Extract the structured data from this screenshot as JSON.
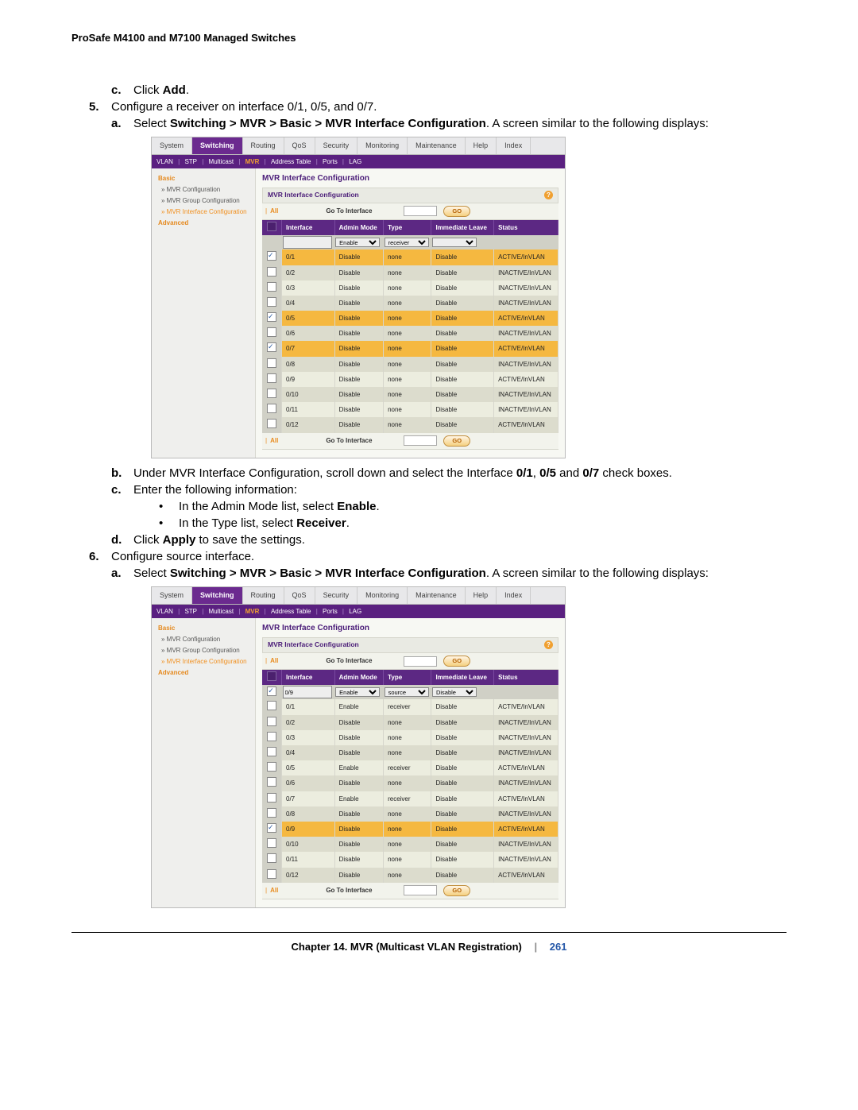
{
  "header": "ProSafe M4100 and M7100 Managed Switches",
  "instructions": {
    "c1": {
      "letter": "c.",
      "pre": "Click ",
      "bold": "Add",
      "post": "."
    },
    "five": {
      "num": "5.",
      "text": "Configure a receiver on interface 0/1, 0/5, and 0/7."
    },
    "a5": {
      "letter": "a.",
      "pre": "Select ",
      "bold": "Switching > MVR > Basic > MVR Interface Configuration",
      "post": ". A screen similar to the following displays:"
    },
    "b5": {
      "letter": "b.",
      "pre": "Under MVR Interface Configuration, scroll down and select the Interface ",
      "b1": "0/1",
      "m1": ", ",
      "b2": "0/5",
      "m2": " and ",
      "b3": "0/7",
      "post": " check boxes."
    },
    "c5": {
      "letter": "c.",
      "text": "Enter the following information:"
    },
    "bul1": {
      "pre": "In the Admin Mode list, select ",
      "bold": "Enable",
      "post": "."
    },
    "bul2": {
      "pre": "In the Type list, select ",
      "bold": "Receiver",
      "post": "."
    },
    "d5": {
      "letter": "d.",
      "pre": "Click ",
      "bold": "Apply",
      "post": " to save the settings."
    },
    "six": {
      "num": "6.",
      "text": "Configure source interface."
    },
    "a6": {
      "letter": "a.",
      "pre": "Select ",
      "bold": "Switching > MVR > Basic > MVR Interface Configuration",
      "post": ". A screen similar to the following displays:"
    }
  },
  "ui": {
    "tabs": [
      "System",
      "Switching",
      "Routing",
      "QoS",
      "Security",
      "Monitoring",
      "Maintenance",
      "Help",
      "Index"
    ],
    "activeTab": "Switching",
    "subtabs": [
      "VLAN",
      "STP",
      "Multicast",
      "MVR",
      "Address Table",
      "Ports",
      "LAG"
    ],
    "activeSub": "MVR",
    "sidebar": {
      "basic": "Basic",
      "mvrcfg": "» MVR Configuration",
      "grpcfg": "» MVR Group Configuration",
      "ifcfg": "» MVR Interface Configuration",
      "advanced": "Advanced"
    },
    "mainTitle": "MVR Interface Configuration",
    "cfgBar": "MVR Interface Configuration",
    "all": "All",
    "goTo": "Go To Interface",
    "go": "GO",
    "cols": {
      "iface": "Interface",
      "mode": "Admin Mode",
      "type": "Type",
      "leave": "Immediate Leave",
      "status": "Status"
    }
  },
  "panel1": {
    "controls": {
      "mode": "Enable",
      "type": "receiver",
      "leave": ""
    },
    "rows": [
      {
        "cb": true,
        "iface": "0/1",
        "mode": "Disable",
        "type": "none",
        "leave": "Disable",
        "status": "ACTIVE/InVLAN",
        "hl": true
      },
      {
        "cb": false,
        "iface": "0/2",
        "mode": "Disable",
        "type": "none",
        "leave": "Disable",
        "status": "INACTIVE/InVLAN",
        "hl": false
      },
      {
        "cb": false,
        "iface": "0/3",
        "mode": "Disable",
        "type": "none",
        "leave": "Disable",
        "status": "INACTIVE/InVLAN",
        "hl": false
      },
      {
        "cb": false,
        "iface": "0/4",
        "mode": "Disable",
        "type": "none",
        "leave": "Disable",
        "status": "INACTIVE/InVLAN",
        "hl": false
      },
      {
        "cb": true,
        "iface": "0/5",
        "mode": "Disable",
        "type": "none",
        "leave": "Disable",
        "status": "ACTIVE/InVLAN",
        "hl": true
      },
      {
        "cb": false,
        "iface": "0/6",
        "mode": "Disable",
        "type": "none",
        "leave": "Disable",
        "status": "INACTIVE/InVLAN",
        "hl": false
      },
      {
        "cb": true,
        "iface": "0/7",
        "mode": "Disable",
        "type": "none",
        "leave": "Disable",
        "status": "ACTIVE/InVLAN",
        "hl": true
      },
      {
        "cb": false,
        "iface": "0/8",
        "mode": "Disable",
        "type": "none",
        "leave": "Disable",
        "status": "INACTIVE/InVLAN",
        "hl": false
      },
      {
        "cb": false,
        "iface": "0/9",
        "mode": "Disable",
        "type": "none",
        "leave": "Disable",
        "status": "ACTIVE/InVLAN",
        "hl": false
      },
      {
        "cb": false,
        "iface": "0/10",
        "mode": "Disable",
        "type": "none",
        "leave": "Disable",
        "status": "INACTIVE/InVLAN",
        "hl": false
      },
      {
        "cb": false,
        "iface": "0/11",
        "mode": "Disable",
        "type": "none",
        "leave": "Disable",
        "status": "INACTIVE/InVLAN",
        "hl": false
      },
      {
        "cb": false,
        "iface": "0/12",
        "mode": "Disable",
        "type": "none",
        "leave": "Disable",
        "status": "ACTIVE/InVLAN",
        "hl": false
      }
    ]
  },
  "panel2": {
    "controls": {
      "mode": "Enable",
      "type": "source",
      "leave": "Disable",
      "iface": "0/9"
    },
    "rows": [
      {
        "cb": false,
        "iface": "0/1",
        "mode": "Enable",
        "type": "receiver",
        "leave": "Disable",
        "status": "ACTIVE/InVLAN",
        "hl": false
      },
      {
        "cb": false,
        "iface": "0/2",
        "mode": "Disable",
        "type": "none",
        "leave": "Disable",
        "status": "INACTIVE/InVLAN",
        "hl": false
      },
      {
        "cb": false,
        "iface": "0/3",
        "mode": "Disable",
        "type": "none",
        "leave": "Disable",
        "status": "INACTIVE/InVLAN",
        "hl": false
      },
      {
        "cb": false,
        "iface": "0/4",
        "mode": "Disable",
        "type": "none",
        "leave": "Disable",
        "status": "INACTIVE/InVLAN",
        "hl": false
      },
      {
        "cb": false,
        "iface": "0/5",
        "mode": "Enable",
        "type": "receiver",
        "leave": "Disable",
        "status": "ACTIVE/InVLAN",
        "hl": false
      },
      {
        "cb": false,
        "iface": "0/6",
        "mode": "Disable",
        "type": "none",
        "leave": "Disable",
        "status": "INACTIVE/InVLAN",
        "hl": false
      },
      {
        "cb": false,
        "iface": "0/7",
        "mode": "Enable",
        "type": "receiver",
        "leave": "Disable",
        "status": "ACTIVE/InVLAN",
        "hl": false
      },
      {
        "cb": false,
        "iface": "0/8",
        "mode": "Disable",
        "type": "none",
        "leave": "Disable",
        "status": "INACTIVE/InVLAN",
        "hl": false
      },
      {
        "cb": true,
        "iface": "0/9",
        "mode": "Disable",
        "type": "none",
        "leave": "Disable",
        "status": "ACTIVE/InVLAN",
        "hl": true
      },
      {
        "cb": false,
        "iface": "0/10",
        "mode": "Disable",
        "type": "none",
        "leave": "Disable",
        "status": "INACTIVE/InVLAN",
        "hl": false
      },
      {
        "cb": false,
        "iface": "0/11",
        "mode": "Disable",
        "type": "none",
        "leave": "Disable",
        "status": "INACTIVE/InVLAN",
        "hl": false
      },
      {
        "cb": false,
        "iface": "0/12",
        "mode": "Disable",
        "type": "none",
        "leave": "Disable",
        "status": "ACTIVE/InVLAN",
        "hl": false
      }
    ]
  },
  "footer": {
    "chapter": "Chapter 14.  MVR (Multicast VLAN Registration)",
    "page": "261"
  }
}
